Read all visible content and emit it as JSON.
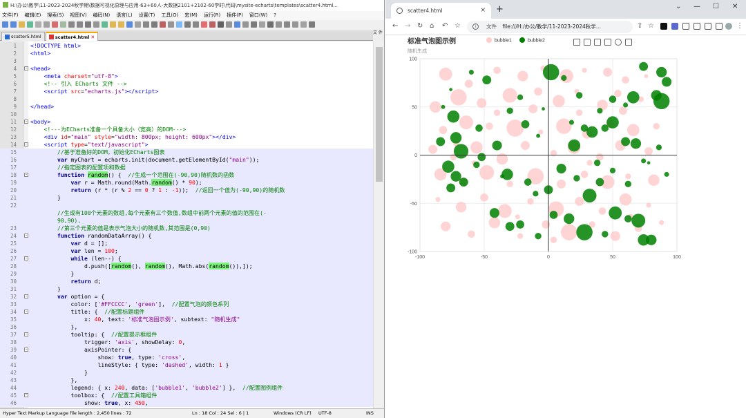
{
  "npp": {
    "title": "H:\\办公\\教学\\11-2023-2024秋学期\\数据可视化原理与应用-63+60人-大数据2101+2102-60学时\\代码\\mysite-echarts\\templates\\scatter4.html...",
    "menu": [
      "文件(F)",
      "编辑(E)",
      "搜索(S)",
      "视图(V)",
      "编码(N)",
      "语言(L)",
      "设置(T)",
      "工具(O)",
      "宏(M)",
      "运行(R)",
      "插件(P)",
      "窗口(W)",
      "?"
    ],
    "tabs": [
      {
        "label": "scatter5.html",
        "active": false
      },
      {
        "label": "scatter4.html",
        "active": true
      }
    ],
    "side_tab": "文 件",
    "status": {
      "type": "Hyper Text Markup Language file length : 2,450    lines : 72",
      "pos": "Ln : 18    Col : 24    Sel : 6 | 1",
      "eol": "Windows (CR LF)",
      "enc": "UTF-8",
      "ins": "INS"
    },
    "lines": [
      {
        "n": "1",
        "h": "<span class='tag'>&lt;!DOCTYPE html&gt;</span>"
      },
      {
        "n": "2",
        "h": "<span class='tag'>&lt;html&gt;</span>"
      },
      {
        "n": "3",
        "h": ""
      },
      {
        "n": "4",
        "h": "<span class='tag'>&lt;head&gt;</span>",
        "fold": "-"
      },
      {
        "n": "5",
        "h": "    <span class='tag'>&lt;meta</span> <span class='attr'>charset</span>=<span class='str'>\"utf-8\"</span><span class='tag'>&gt;</span>"
      },
      {
        "n": "6",
        "h": "    <span class='cm'>&lt;!-- 引入 ECharts 文件 --&gt;</span>"
      },
      {
        "n": "7",
        "h": "    <span class='tag'>&lt;script</span> <span class='attr'>src</span>=<span class='str'>\"echarts.js\"</span><span class='tag'>&gt;&lt;/script&gt;</span>"
      },
      {
        "n": "8",
        "h": ""
      },
      {
        "n": "9",
        "h": "<span class='tag'>&lt;/head&gt;</span>"
      },
      {
        "n": "10",
        "h": ""
      },
      {
        "n": "11",
        "h": "<span class='tag'>&lt;body&gt;</span>",
        "fold": "-"
      },
      {
        "n": "12",
        "h": "    <span class='cm'>&lt;!---为ECharts准备一个具备大小（宽高）的DOM---&gt;</span>"
      },
      {
        "n": "13",
        "h": "    <span class='tag'>&lt;div</span> <span class='attr'>id</span>=<span class='str'>\"main\"</span> <span class='attr'>style</span>=<span class='str'>\"width: 800px; height: 600px\"</span><span class='tag'>&gt;&lt;/div&gt;</span>"
      },
      {
        "n": "14",
        "h": "    <span class='tag'>&lt;script</span> <span class='attr'>type</span>=<span class='str'>\"text/javascript\"</span><span class='tag'>&gt;</span>",
        "fold": "-"
      },
      {
        "n": "15",
        "h": "        <span class='cm'>//基于准备好的DOM，初始化ECharts图表</span>",
        "hl": true
      },
      {
        "n": "16",
        "h": "        <span class='kw'>var</span> myChart = echarts.init(document.getElementById(<span class='str'>\"main\"</span>));",
        "hl": true
      },
      {
        "n": "17",
        "h": "        <span class='cm'>//指定图表的配置项和数据</span>",
        "hl": true
      },
      {
        "n": "18",
        "h": "        <span class='kw'>function</span> <span class='hi'>random</span>() {  <span class='cm'>//生成一个范围在(-90,90)随机数的函数</span>",
        "hl": true,
        "cur": true,
        "fold": "-"
      },
      {
        "n": "19",
        "h": "            <span class='kw'>var</span> r = Math.round(Math.<span class='hi'>random</span>() * <span class='num'>90</span>);",
        "hl": true
      },
      {
        "n": "20",
        "h": "            <span class='kw'>return</span> (r * (r % <span class='num'>2</span> == <span class='num'>0</span> ? <span class='num'>1</span> : <span class='num'>-1</span>));  <span class='cm'>//返回一个值为(-90,90)的随机数</span>",
        "hl": true
      },
      {
        "n": "21",
        "h": "        }",
        "hl": true
      },
      {
        "n": "22",
        "h": "",
        "hl": true
      },
      {
        "n": "",
        "h": "        <span class='cm'>//生成有100个元素的数组,每个元素有三个数值,数组中前两个元素的值的范围在(-</span>",
        "hl": true
      },
      {
        "n": "",
        "h": "        <span class='cm'>90,90),</span>",
        "hl": true
      },
      {
        "n": "23",
        "h": "        <span class='cm'>//第三个元素的值是表示气泡大小的随机数,其范围是(0,90)</span>",
        "hl": true
      },
      {
        "n": "24",
        "h": "        <span class='kw'>function</span> randomDataArray() {",
        "hl": true,
        "fold": "-"
      },
      {
        "n": "25",
        "h": "            <span class='kw'>var</span> d = [];",
        "hl": true
      },
      {
        "n": "26",
        "h": "            <span class='kw'>var</span> len = <span class='num'>100</span>;",
        "hl": true
      },
      {
        "n": "27",
        "h": "            <span class='kw'>while</span> (len--) {",
        "hl": true,
        "fold": "-"
      },
      {
        "n": "28",
        "h": "                d.push([<span class='hi'>random</span>(), <span class='hi'>random</span>(), Math.abs(<span class='hi'>random</span>()),]);",
        "hl": true
      },
      {
        "n": "29",
        "h": "            }",
        "hl": true
      },
      {
        "n": "30",
        "h": "            <span class='kw'>return</span> d;",
        "hl": true
      },
      {
        "n": "31",
        "h": "        }",
        "hl": true
      },
      {
        "n": "32",
        "h": "        <span class='kw'>var</span> option = {",
        "hl": true,
        "fold": "-"
      },
      {
        "n": "33",
        "h": "            color: [<span class='str'>'#FFCCCC'</span>, <span class='str'>'green'</span>],  <span class='cm'>//配置气泡的颜色系列</span>",
        "hl": true
      },
      {
        "n": "34",
        "h": "            title: {  <span class='cm'>//配置标题组件</span>",
        "hl": true,
        "fold": "-"
      },
      {
        "n": "35",
        "h": "                x: <span class='num'>40</span>, text: <span class='str'>'标准气泡图示例'</span>, subtext: <span class='str'>\"随机生成\"</span>",
        "hl": true
      },
      {
        "n": "36",
        "h": "            },",
        "hl": true
      },
      {
        "n": "37",
        "h": "            tooltip: {  <span class='cm'>//配置提示框组件</span>",
        "hl": true,
        "fold": "-"
      },
      {
        "n": "38",
        "h": "                trigger: <span class='str'>'axis'</span>, showDelay: <span class='num'>0</span>,",
        "hl": true
      },
      {
        "n": "39",
        "h": "                axisPointer: {",
        "hl": true,
        "fold": "-"
      },
      {
        "n": "40",
        "h": "                    show: <span class='kw'>true</span>, type: <span class='str'>'cross'</span>,",
        "hl": true
      },
      {
        "n": "41",
        "h": "                    lineStyle: { type: <span class='str'>'dashed'</span>, width: <span class='num'>1</span> }",
        "hl": true
      },
      {
        "n": "42",
        "h": "                }",
        "hl": true
      },
      {
        "n": "43",
        "h": "            },",
        "hl": true
      },
      {
        "n": "44",
        "h": "            legend: { x: <span class='num'>240</span>, data: [<span class='str'>'bubble1'</span>, <span class='str'>'bubble2'</span>] },  <span class='cm'>//配置图例组件</span>",
        "hl": true
      },
      {
        "n": "45",
        "h": "            toolbox: {  <span class='cm'>//配置工具箱组件</span>",
        "hl": true,
        "fold": "-"
      },
      {
        "n": "46",
        "h": "                show: <span class='kw'>true</span>, x: <span class='num'>450</span>,",
        "hl": true
      }
    ]
  },
  "browser": {
    "tab_title": "scatter4.html",
    "tab_close": "×",
    "new_tab": "+",
    "file_label": "文件",
    "url": "file:///H:/办公/教学/11-2023-2024秋学...",
    "win_buttons": [
      "⌄",
      "—",
      "☐",
      "✕"
    ]
  },
  "chart_data": {
    "type": "scatter",
    "title": "标准气泡图示例",
    "subtitle": "随机生成",
    "legend_position": "top",
    "grid": true,
    "xlim": [
      -100,
      100
    ],
    "ylim": [
      -100,
      100
    ],
    "xticks": [
      "-100",
      "-50",
      "0",
      "50",
      "100"
    ],
    "yticks": [
      "100",
      "50",
      "0",
      "-50",
      "-100"
    ],
    "series": [
      {
        "name": "bubble1",
        "color": "#FFCCCC",
        "points": [
          [
            -80,
            84,
            32
          ],
          [
            -62,
            74,
            20
          ],
          [
            -40,
            88,
            18
          ],
          [
            -20,
            82,
            26
          ],
          [
            -4,
            90,
            14
          ],
          [
            14,
            82,
            34
          ],
          [
            28,
            88,
            12
          ],
          [
            46,
            86,
            22
          ],
          [
            60,
            78,
            18
          ],
          [
            76,
            82,
            10
          ],
          [
            -88,
            50,
            28
          ],
          [
            -70,
            60,
            40
          ],
          [
            -52,
            54,
            24
          ],
          [
            -30,
            62,
            36
          ],
          [
            -12,
            48,
            22
          ],
          [
            8,
            56,
            30
          ],
          [
            24,
            44,
            16
          ],
          [
            42,
            52,
            26
          ],
          [
            58,
            46,
            20
          ],
          [
            72,
            58,
            14
          ],
          [
            -82,
            26,
            20
          ],
          [
            -64,
            34,
            34
          ],
          [
            -46,
            30,
            18
          ],
          [
            -26,
            28,
            42
          ],
          [
            -6,
            24,
            12
          ],
          [
            12,
            30,
            38
          ],
          [
            30,
            22,
            24
          ],
          [
            48,
            32,
            20
          ],
          [
            66,
            26,
            30
          ],
          [
            84,
            30,
            16
          ],
          [
            -90,
            6,
            22
          ],
          [
            -74,
            -2,
            16
          ],
          [
            -56,
            8,
            30
          ],
          [
            -36,
            -4,
            28
          ],
          [
            -18,
            10,
            22
          ],
          [
            4,
            2,
            16
          ],
          [
            20,
            8,
            32
          ],
          [
            40,
            -2,
            18
          ],
          [
            56,
            10,
            26
          ],
          [
            78,
            4,
            20
          ],
          [
            -84,
            -20,
            30
          ],
          [
            -66,
            -28,
            20
          ],
          [
            -48,
            -18,
            36
          ],
          [
            -30,
            -30,
            16
          ],
          [
            -10,
            -22,
            40
          ],
          [
            10,
            -30,
            22
          ],
          [
            28,
            -20,
            18
          ],
          [
            46,
            -28,
            34
          ],
          [
            62,
            -22,
            14
          ],
          [
            82,
            -26,
            28
          ],
          [
            -86,
            -46,
            12
          ],
          [
            -68,
            -54,
            26
          ],
          [
            -50,
            -44,
            20
          ],
          [
            -34,
            -58,
            34
          ],
          [
            -14,
            -48,
            16
          ],
          [
            6,
            -56,
            38
          ],
          [
            24,
            -48,
            22
          ],
          [
            42,
            -58,
            18
          ],
          [
            60,
            -46,
            30
          ],
          [
            78,
            -52,
            12
          ],
          [
            -80,
            -74,
            24
          ],
          [
            -60,
            -82,
            18
          ],
          [
            -42,
            -70,
            28
          ],
          [
            -22,
            -84,
            14
          ],
          [
            -2,
            -72,
            20
          ],
          [
            16,
            -80,
            40
          ],
          [
            34,
            -72,
            16
          ],
          [
            52,
            -84,
            24
          ],
          [
            70,
            -76,
            18
          ],
          [
            88,
            -70,
            12
          ],
          [
            -72,
            12,
            14
          ],
          [
            -40,
            44,
            16
          ],
          [
            -8,
            66,
            20
          ],
          [
            22,
            66,
            12
          ],
          [
            54,
            64,
            18
          ],
          [
            -58,
            -8,
            12
          ],
          [
            32,
            -8,
            14
          ],
          [
            -24,
            -64,
            12
          ],
          [
            4,
            -88,
            16
          ],
          [
            64,
            -64,
            14
          ]
        ]
      },
      {
        "name": "bubble2",
        "color": "#008000",
        "points": [
          [
            2,
            86,
            40
          ],
          [
            12,
            80,
            14
          ],
          [
            -60,
            86,
            12
          ],
          [
            -76,
            68,
            8
          ],
          [
            -48,
            78,
            22
          ],
          [
            -22,
            60,
            14
          ],
          [
            -30,
            46,
            16
          ],
          [
            -4,
            48,
            8
          ],
          [
            18,
            34,
            12
          ],
          [
            -82,
            50,
            10
          ],
          [
            -74,
            40,
            30
          ],
          [
            -54,
            28,
            18
          ],
          [
            -72,
            18,
            28
          ],
          [
            -84,
            14,
            22
          ],
          [
            -68,
            4,
            36
          ],
          [
            -52,
            -2,
            20
          ],
          [
            -40,
            10,
            24
          ],
          [
            -18,
            32,
            20
          ],
          [
            -8,
            20,
            10
          ],
          [
            20,
            10,
            30
          ],
          [
            28,
            28,
            18
          ],
          [
            34,
            24,
            28
          ],
          [
            44,
            28,
            18
          ],
          [
            50,
            34,
            30
          ],
          [
            60,
            14,
            22
          ],
          [
            68,
            12,
            26
          ],
          [
            86,
            8,
            14
          ],
          [
            74,
            -6,
            12
          ],
          [
            78,
            -8,
            8
          ],
          [
            92,
            -20,
            12
          ],
          [
            88,
            56,
            40
          ],
          [
            84,
            62,
            26
          ],
          [
            66,
            60,
            30
          ],
          [
            74,
            92,
            22
          ],
          [
            88,
            86,
            26
          ],
          [
            92,
            76,
            24
          ],
          [
            50,
            58,
            18
          ],
          [
            60,
            52,
            12
          ],
          [
            40,
            46,
            14
          ],
          [
            24,
            62,
            16
          ],
          [
            -78,
            -12,
            30
          ],
          [
            -72,
            -22,
            26
          ],
          [
            -66,
            -28,
            22
          ],
          [
            -56,
            -10,
            16
          ],
          [
            -32,
            -20,
            28
          ],
          [
            -16,
            -28,
            18
          ],
          [
            -10,
            -40,
            14
          ],
          [
            0,
            -36,
            22
          ],
          [
            10,
            -14,
            24
          ],
          [
            22,
            -24,
            16
          ],
          [
            32,
            -42,
            34
          ],
          [
            40,
            -28,
            20
          ],
          [
            50,
            -16,
            14
          ],
          [
            62,
            -30,
            16
          ],
          [
            -76,
            -34,
            22
          ],
          [
            -42,
            -60,
            24
          ],
          [
            -30,
            -74,
            22
          ],
          [
            -22,
            -72,
            20
          ],
          [
            4,
            -62,
            20
          ],
          [
            16,
            -66,
            26
          ],
          [
            28,
            -80,
            40
          ],
          [
            44,
            -82,
            16
          ],
          [
            52,
            -60,
            32
          ],
          [
            62,
            -66,
            18
          ],
          [
            70,
            -68,
            34
          ],
          [
            74,
            -88,
            28
          ],
          [
            80,
            -88,
            26
          ],
          [
            -8,
            -84,
            16
          ],
          [
            -36,
            -22,
            10
          ],
          [
            38,
            -8,
            16
          ]
        ]
      }
    ]
  }
}
